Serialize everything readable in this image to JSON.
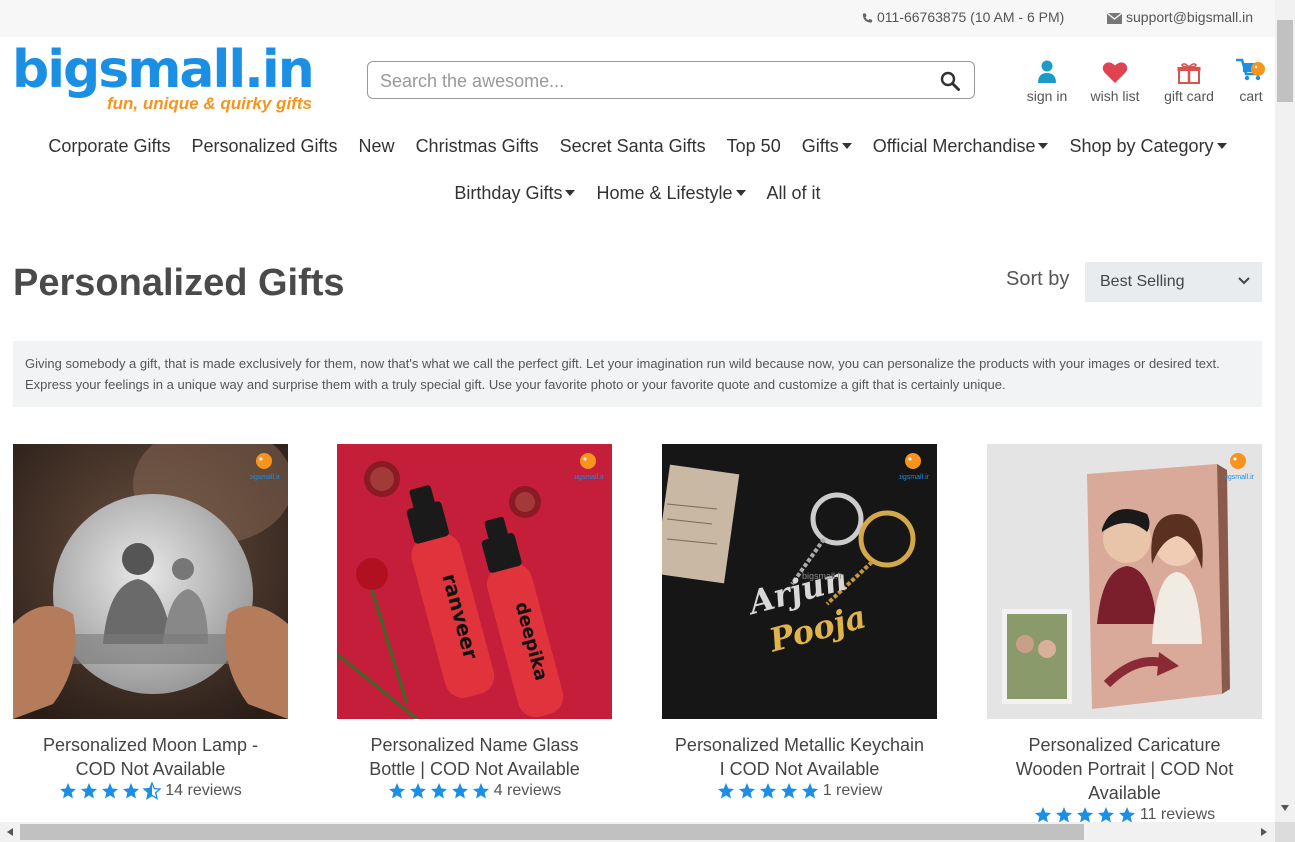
{
  "topbar": {
    "phone": "011-66763875 (10 AM - 6 PM)",
    "email": "support@bigsmall.in"
  },
  "logo": {
    "word": "bigsmall.in",
    "tagline": "fun, unique & quirky gifts"
  },
  "search": {
    "placeholder": "Search the awesome..."
  },
  "header_links": [
    {
      "label": "sign in",
      "icon": "user-icon"
    },
    {
      "label": "wish list",
      "icon": "heart-icon"
    },
    {
      "label": "gift card",
      "icon": "gift-icon"
    },
    {
      "label": "cart",
      "icon": "cart-icon"
    }
  ],
  "nav_row1": [
    {
      "label": "Corporate Gifts",
      "dropdown": false
    },
    {
      "label": "Personalized Gifts",
      "dropdown": false
    },
    {
      "label": "New",
      "dropdown": false
    },
    {
      "label": "Christmas Gifts",
      "dropdown": false
    },
    {
      "label": "Secret Santa Gifts",
      "dropdown": false
    },
    {
      "label": "Top 50",
      "dropdown": false
    },
    {
      "label": "Gifts",
      "dropdown": true
    },
    {
      "label": "Official Merchandise",
      "dropdown": true
    },
    {
      "label": "Shop by Category",
      "dropdown": true
    }
  ],
  "nav_row2": [
    {
      "label": "Birthday Gifts",
      "dropdown": true
    },
    {
      "label": "Home & Lifestyle",
      "dropdown": true
    },
    {
      "label": "All of it",
      "dropdown": false
    }
  ],
  "page": {
    "title": "Personalized Gifts",
    "sort_label": "Sort by",
    "sort_value": "Best Selling",
    "description": "Giving somebody a gift, that is made exclusively for them, now that's what we call the perfect gift. Let your imagination run wild because now, you can personalize the products with your images or desired text. Express your feelings in a unique way and surprise them with a truly special gift. Use your favorite photo or your favorite quote and customize a gift that is certainly unique."
  },
  "products": [
    {
      "name": "Personalized Moon Lamp - COD Not Available",
      "rating": 4.5,
      "reviews": "14 reviews"
    },
    {
      "name": "Personalized Name Glass Bottle | COD Not Available",
      "rating": 5,
      "reviews": "4 reviews"
    },
    {
      "name": "Personalized Metallic Keychain I COD Not Available",
      "rating": 5,
      "reviews": "1 review"
    },
    {
      "name": "Personalized Caricature Wooden Portrait | COD Not Available",
      "rating": 5,
      "reviews": "11 reviews"
    }
  ],
  "image_text": {
    "bottle_1": "ranveer",
    "bottle_2": "deepika",
    "key_1": "Arjun",
    "key_2": "Pooja",
    "watermark": "bigsmall.in"
  },
  "colors": {
    "brand_blue": "#1a8fe3",
    "brand_orange": "#f7941d",
    "star_blue": "#1a8fe3",
    "heart_red": "#e0424f",
    "user_teal": "#1c9bc8"
  }
}
